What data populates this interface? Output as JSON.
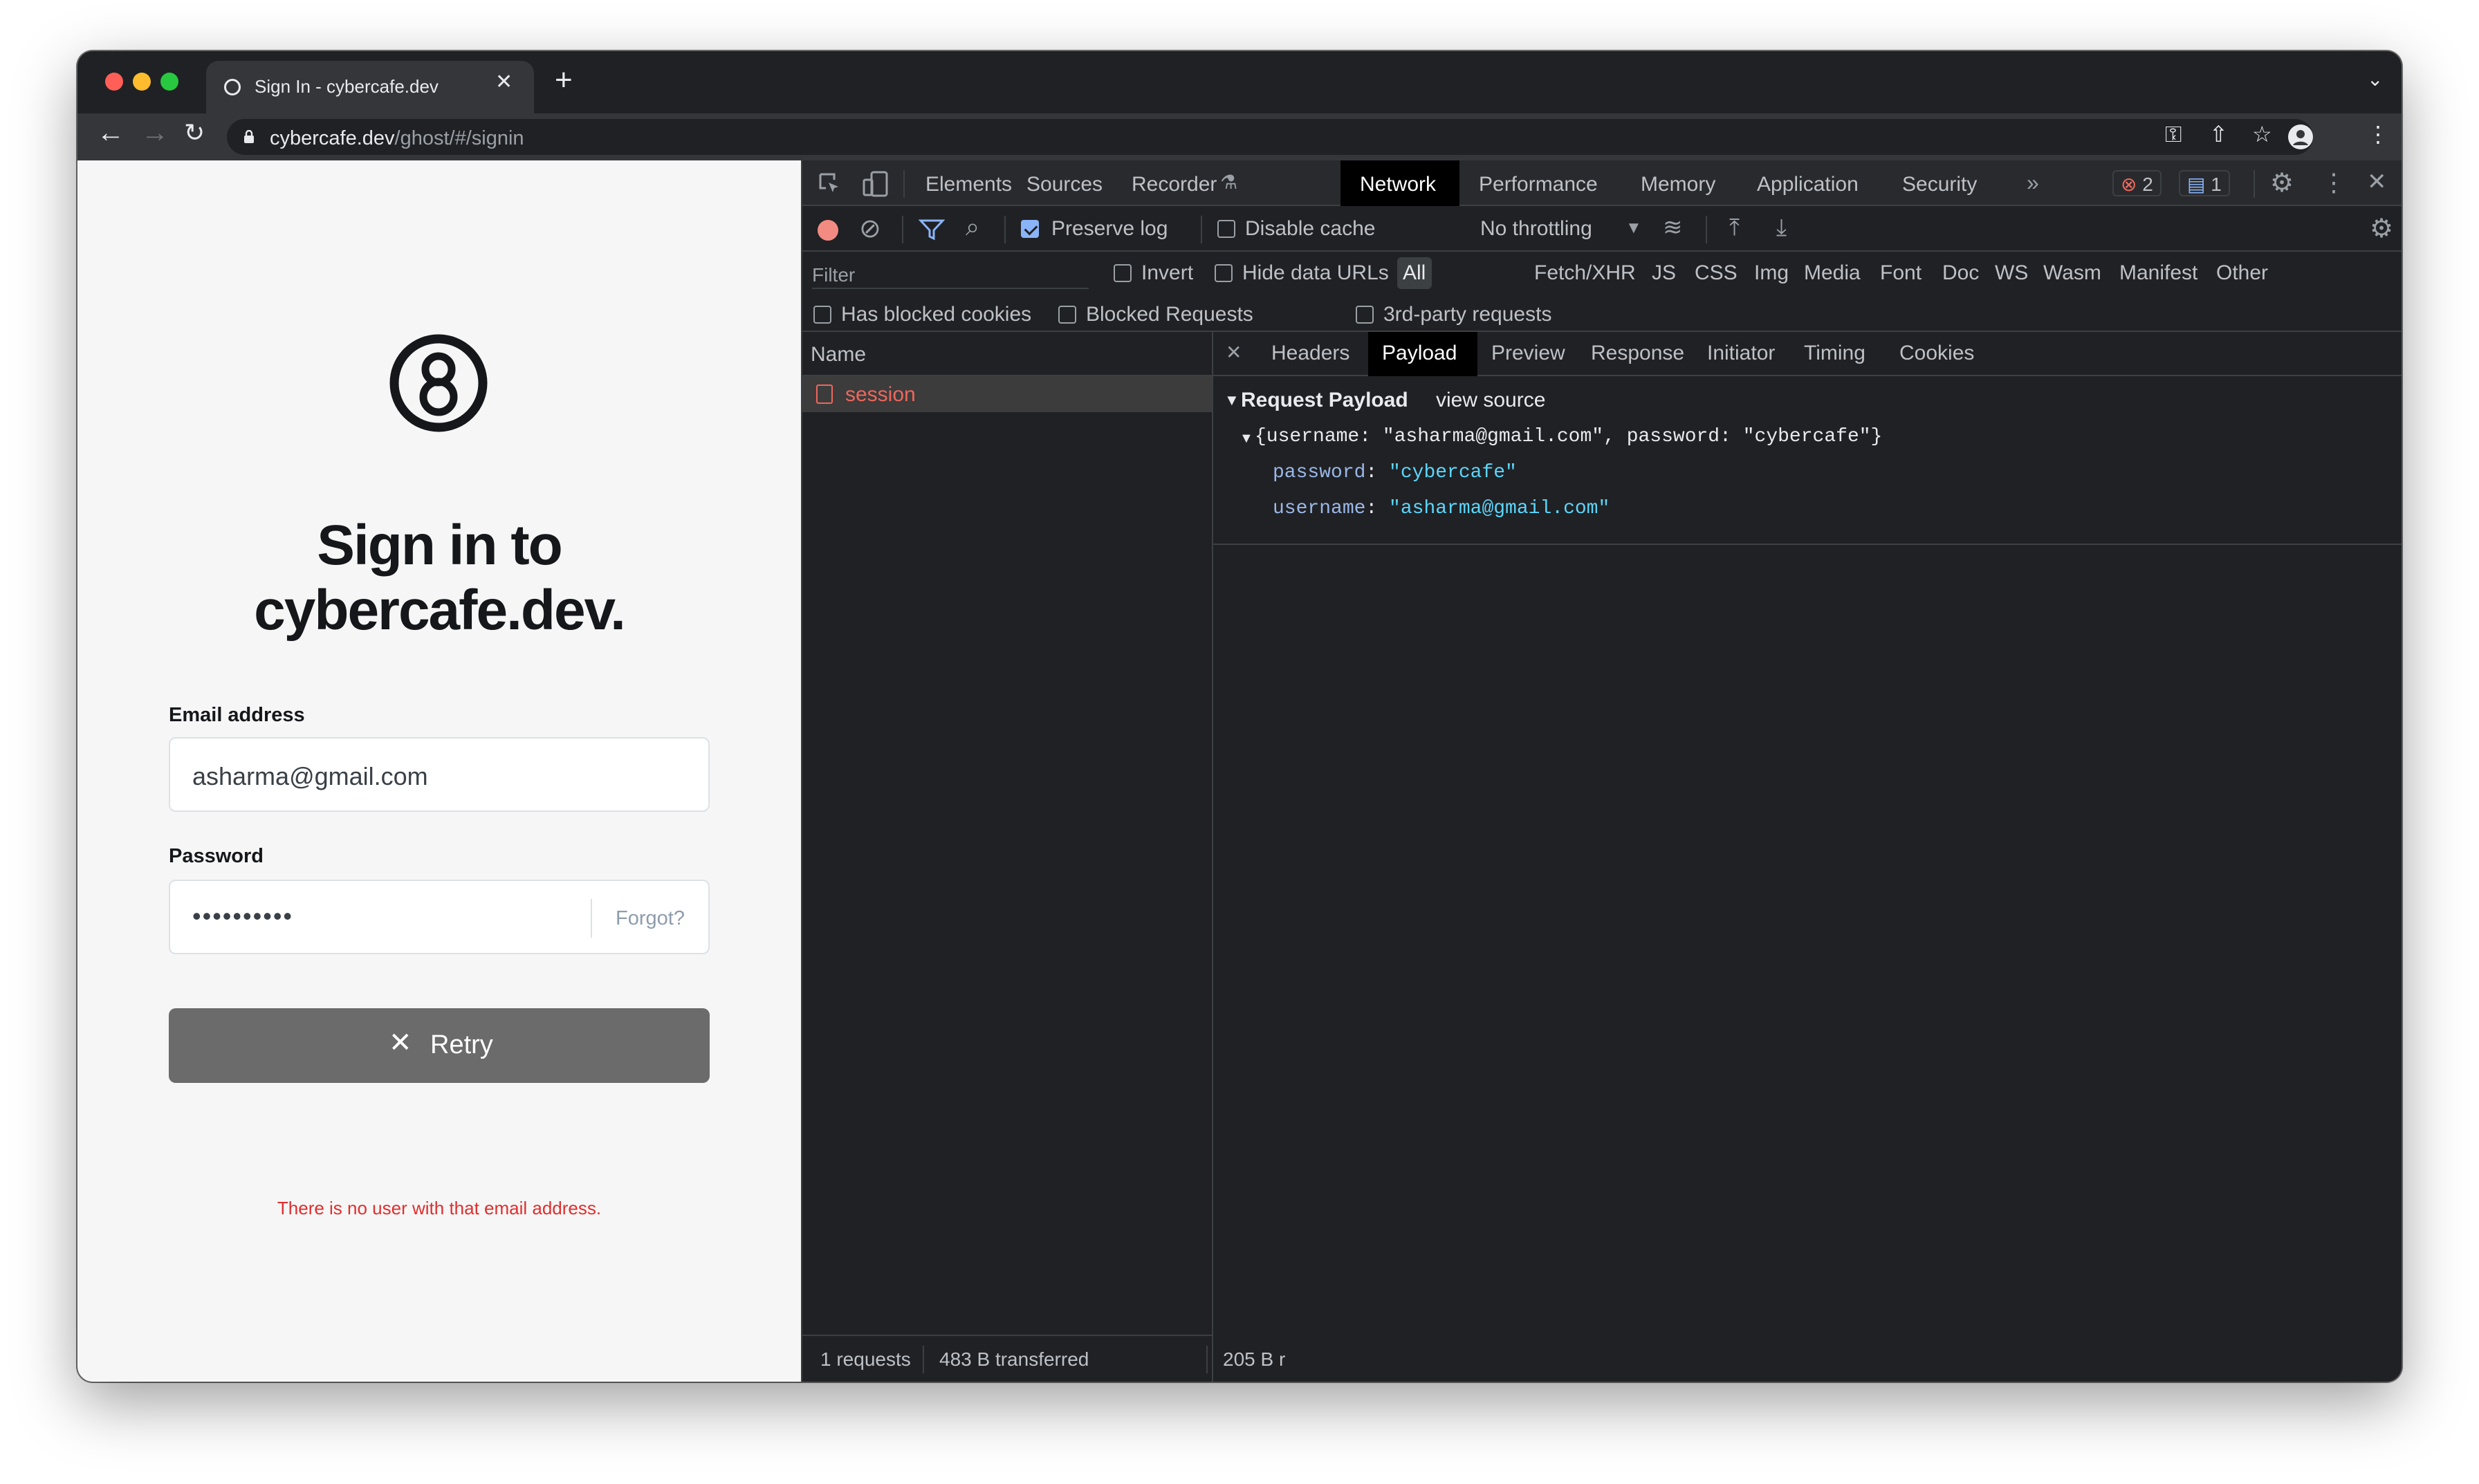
{
  "browser": {
    "tab_title": "Sign In - cybercafe.dev",
    "url_host": "cybercafe.dev",
    "url_path": "/ghost/#/signin"
  },
  "page": {
    "heading_line1": "Sign in to",
    "heading_line2": "cybercafe.dev.",
    "email_label": "Email address",
    "email_value": "asharma@gmail.com",
    "password_label": "Password",
    "password_value": "••••••••••",
    "forgot_label": "Forgot?",
    "retry_label": "Retry",
    "error_text": "There is no user with that email address."
  },
  "devtools": {
    "tabs": [
      "Elements",
      "Sources",
      "Recorder",
      "Network",
      "Performance",
      "Memory",
      "Application",
      "Security"
    ],
    "active_tab": "Network",
    "error_count": "2",
    "message_count": "1",
    "preserve_log_label": "Preserve log",
    "preserve_log_checked": true,
    "disable_cache_label": "Disable cache",
    "throttling": "No throttling",
    "filter_placeholder": "Filter",
    "invert_label": "Invert",
    "hide_data_urls_label": "Hide data URLs",
    "type_filters": [
      "All",
      "Fetch/XHR",
      "JS",
      "CSS",
      "Img",
      "Media",
      "Font",
      "Doc",
      "WS",
      "Wasm",
      "Manifest",
      "Other"
    ],
    "has_blocked_cookies_label": "Has blocked cookies",
    "blocked_requests_label": "Blocked Requests",
    "third_party_label": "3rd-party requests",
    "name_header": "Name",
    "requests": [
      {
        "name": "session",
        "status_color": "#ee675c"
      }
    ],
    "status_bar": {
      "requests": "1 requests",
      "transferred": "483 B transferred",
      "resources": "205 B r"
    },
    "detail_tabs": [
      "Headers",
      "Payload",
      "Preview",
      "Response",
      "Initiator",
      "Timing",
      "Cookies"
    ],
    "active_detail_tab": "Payload",
    "payload": {
      "section_title": "Request Payload",
      "view_source": "view source",
      "summary": "{username: \"asharma@gmail.com\", password: \"cybercafe\"}",
      "fields": [
        {
          "key": "password",
          "value": "\"cybercafe\""
        },
        {
          "key": "username",
          "value": "\"asharma@gmail.com\""
        }
      ]
    }
  }
}
